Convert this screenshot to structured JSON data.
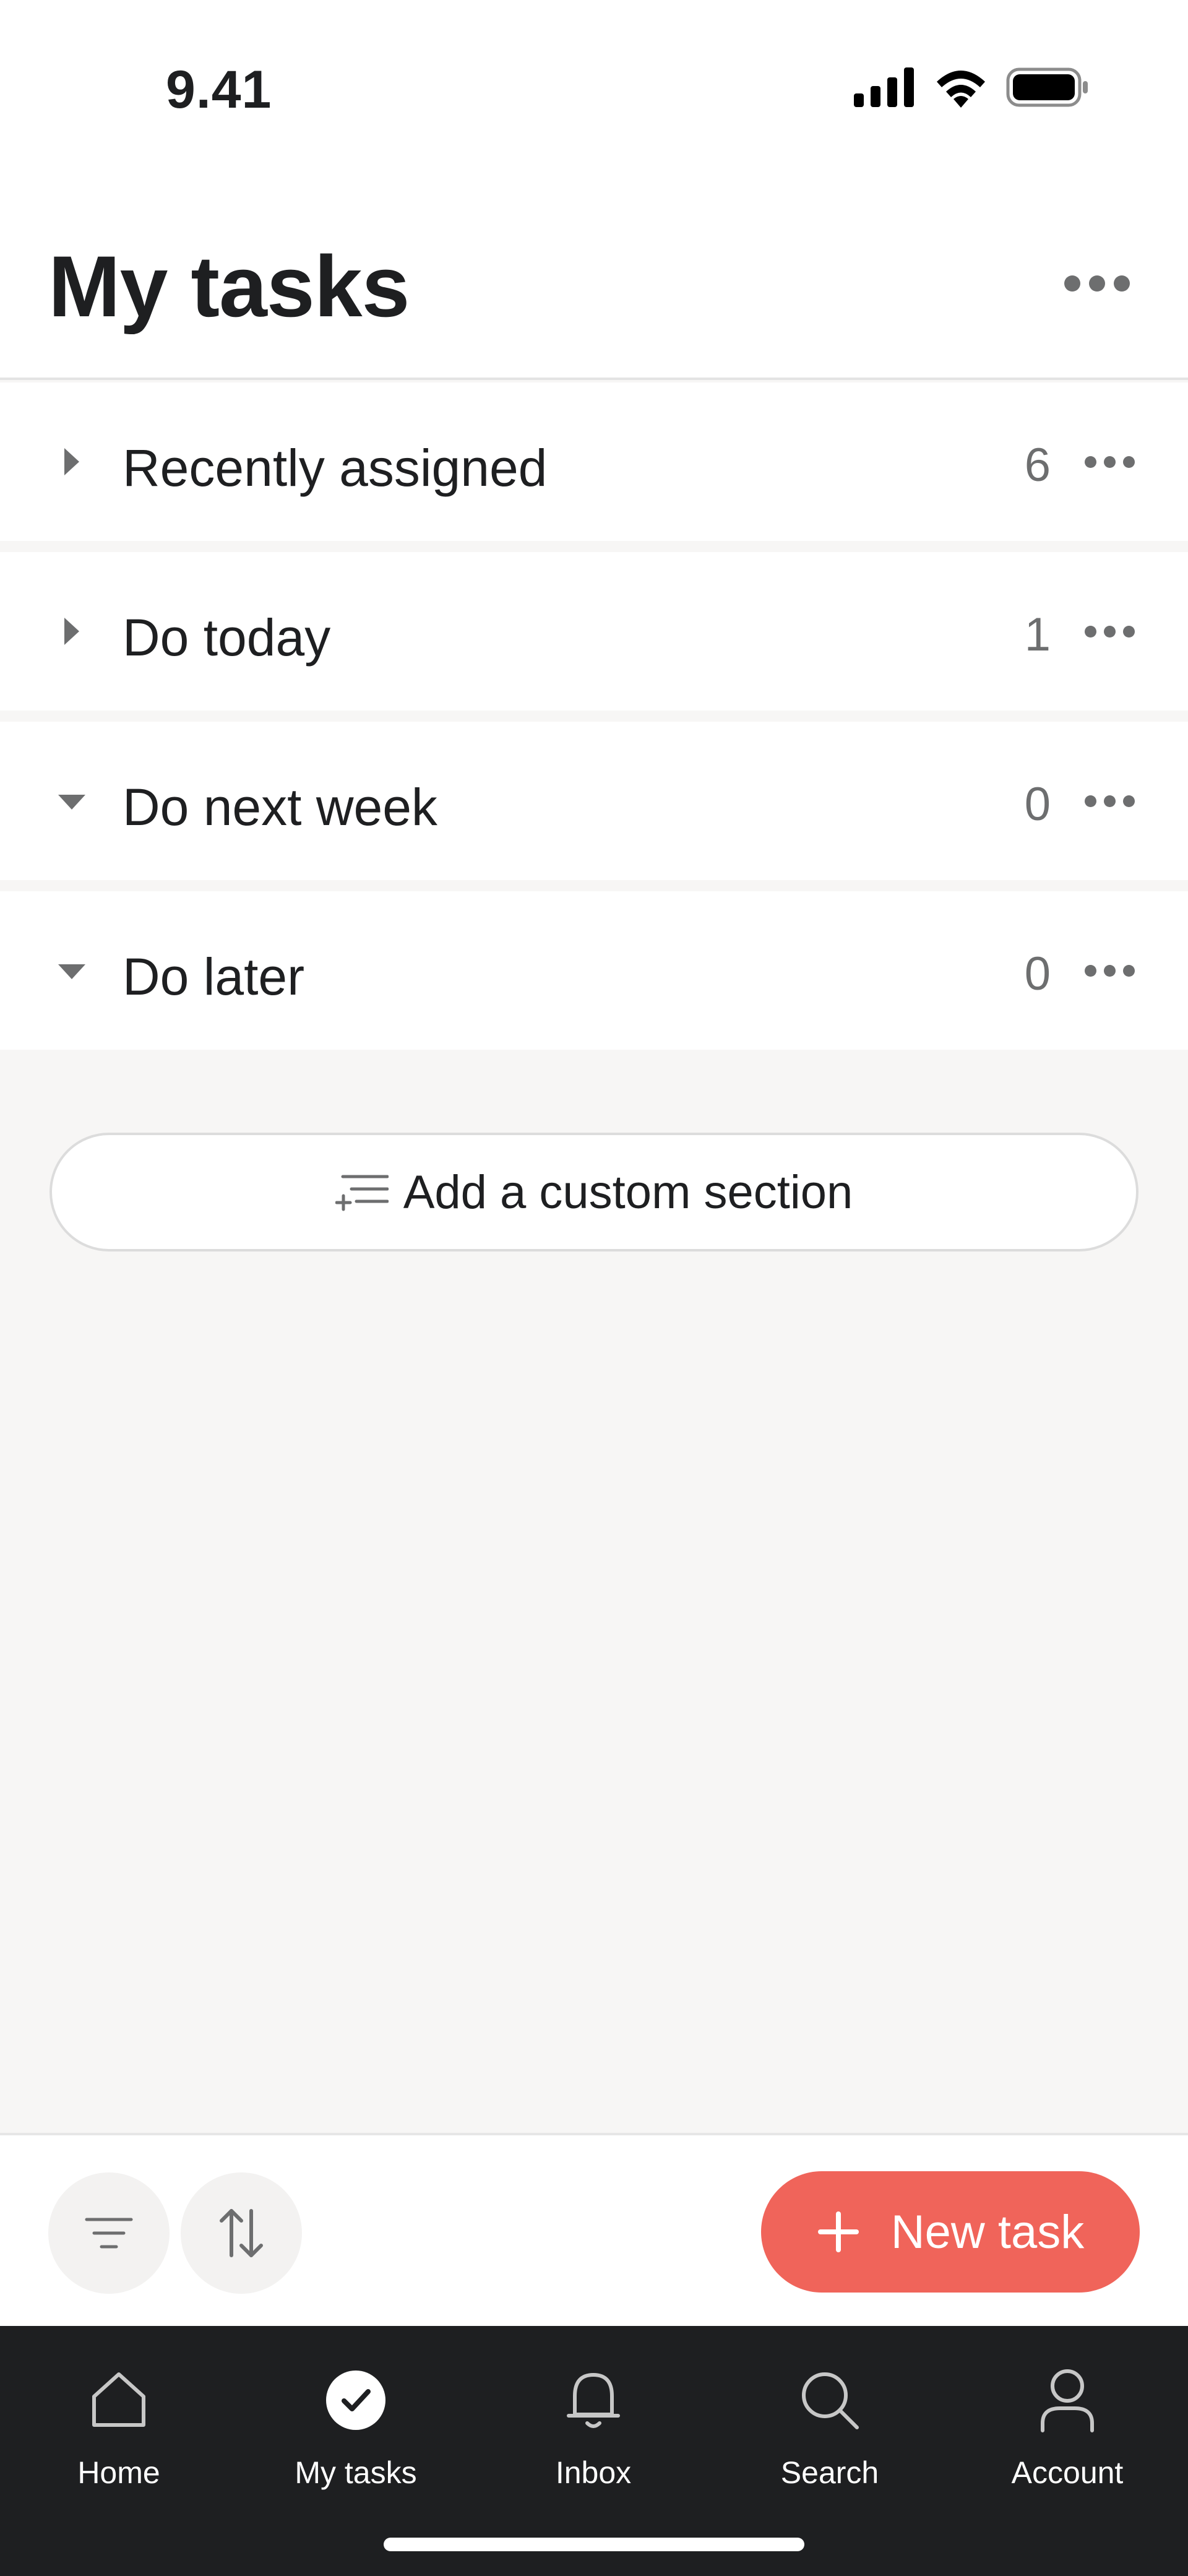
{
  "status_bar": {
    "time": "9.41"
  },
  "header": {
    "title": "My tasks"
  },
  "sections": [
    {
      "label": "Recently assigned",
      "count": "6",
      "expanded": false
    },
    {
      "label": "Do today",
      "count": "1",
      "expanded": false
    },
    {
      "label": "Do next week",
      "count": "0",
      "expanded": true
    },
    {
      "label": "Do later",
      "count": "0",
      "expanded": true
    }
  ],
  "add_section": {
    "label": "Add a custom section"
  },
  "toolbar": {
    "new_task_label": "New task"
  },
  "tabbar": {
    "items": [
      {
        "label": "Home",
        "icon": "home-icon",
        "active": false
      },
      {
        "label": "My tasks",
        "icon": "check-circle-icon",
        "active": true
      },
      {
        "label": "Inbox",
        "icon": "bell-icon",
        "active": false
      },
      {
        "label": "Search",
        "icon": "search-icon",
        "active": false
      },
      {
        "label": "Account",
        "icon": "user-icon",
        "active": false
      }
    ]
  },
  "colors": {
    "accent": "#f0645a",
    "tabbar_bg": "#1e1f21",
    "page_bg": "#f7f6f5",
    "text_primary": "#1e1f21",
    "text_secondary": "#6d6e6f"
  }
}
